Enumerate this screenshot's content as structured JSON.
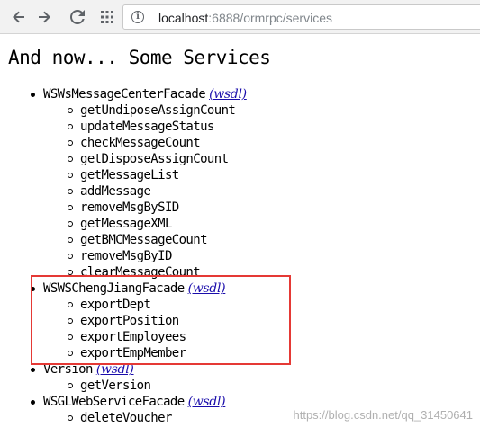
{
  "browser": {
    "url_host": "localhost",
    "url_path": ":6888/ormrpc/services",
    "icons": {
      "back": "arrow-back-icon",
      "forward": "arrow-forward-icon",
      "reload": "reload-icon",
      "apps": "apps-grid-icon",
      "site_info": "info-icon"
    }
  },
  "page": {
    "heading": "And now... Some Services",
    "wsdl_label": "(wsdl)",
    "services": [
      {
        "name": "WSWsMessageCenterFacade",
        "methods": [
          "getUndiposeAssignCount",
          "updateMessageStatus",
          "checkMessageCount",
          "getDisposeAssignCount",
          "getMessageList",
          "addMessage",
          "removeMsgBySID",
          "getMessageXML",
          "getBMCMessageCount",
          "removeMsgByID",
          "clearMessageCount"
        ]
      },
      {
        "name": "WSWSChengJiangFacade",
        "methods": [
          "exportDept",
          "exportPosition",
          "exportEmployees",
          "exportEmpMember"
        ]
      },
      {
        "name": "Version",
        "methods": [
          "getVersion"
        ]
      },
      {
        "name": "WSGLWebServiceFacade",
        "methods": [
          "deleteVoucher"
        ]
      }
    ]
  },
  "annotation": {
    "highlight_color": "#e53935"
  },
  "watermark": "https://blog.csdn.net/qq_31450641",
  "colors": {
    "link": "#1a0dab",
    "toolbar_bg": "#f2f2f2"
  }
}
